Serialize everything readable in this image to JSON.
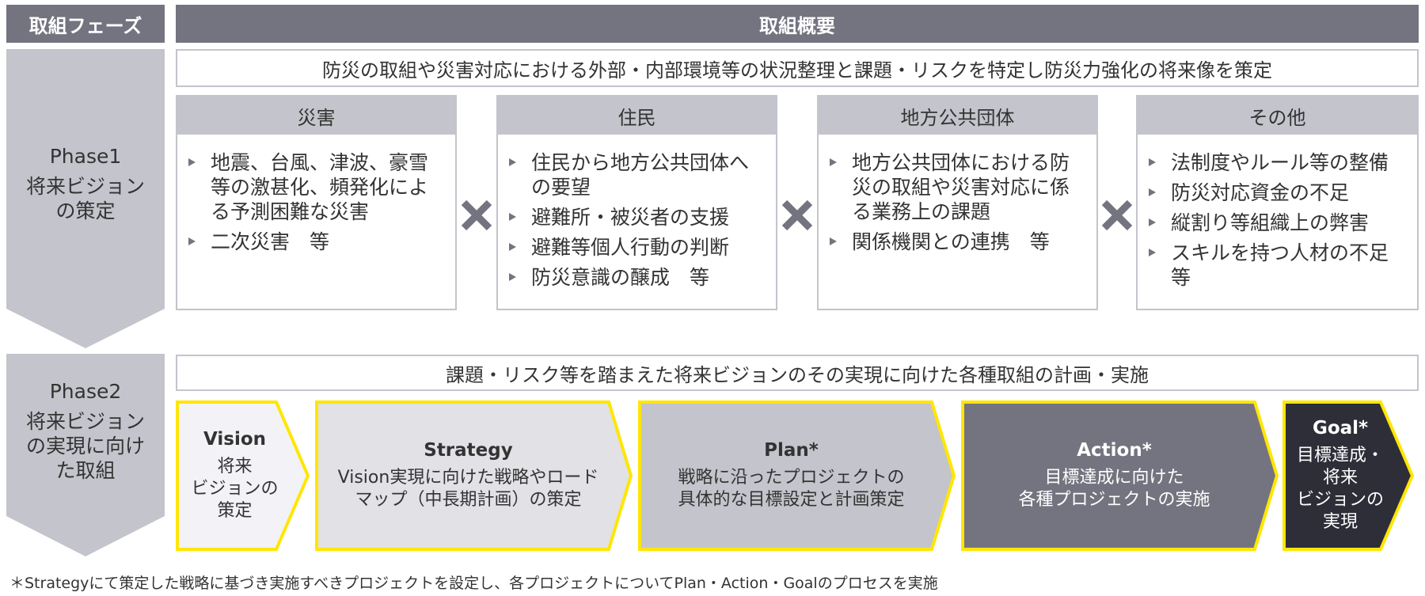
{
  "header": {
    "phase_col": "取組フェーズ",
    "overview_col": "取組概要"
  },
  "phase1": {
    "title": "Phase1",
    "subtitle": "将来ビジョン\nの策定",
    "summary": "防災の取組や災害対応における外部・内部環境等の状況整理と課題・リスクを特定し防災力強化の将来像を策定",
    "cards": [
      {
        "title": "災害",
        "items": [
          "地震、台風、津波、豪雪等の激甚化、頻発化による予測困難な災害",
          "二次災害　等"
        ]
      },
      {
        "title": "住民",
        "items": [
          "住民から地方公共団体への要望",
          "避難所・被災者の支援",
          "避難等個人行動の判断",
          "防災意識の醸成　等"
        ]
      },
      {
        "title": "地方公共団体",
        "items": [
          "地方公共団体における防災の取組や災害対応に係る業務上の課題",
          "関係機関との連携　等"
        ]
      },
      {
        "title": "その他",
        "items": [
          "法制度やルール等の整備",
          "防災対応資金の不足",
          "縦割り等組織上の弊害",
          "スキルを持つ人材の不足等"
        ]
      }
    ],
    "operator_icon": "multiply-icon"
  },
  "phase2": {
    "title": "Phase2",
    "subtitle": "将来ビジョン\nの実現に向け\nた取組",
    "summary": "課題・リスク等を踏まえた将来ビジョンのその実現に向けた各種取組の計画・実施",
    "steps": [
      {
        "title": "Vision",
        "desc": "将来\nビジョンの\n策定",
        "fill": "#f3f3f7",
        "text_color": "#333333"
      },
      {
        "title": "Strategy",
        "desc": "Vision実現に向けた戦略やロード\nマップ（中長期計画）の策定",
        "fill": "#e1e1e6",
        "text_color": "#333333"
      },
      {
        "title": "Plan*",
        "desc": "戦略に沿ったプロジェクトの\n具体的な目標設定と計画策定",
        "fill": "#c4c4cc",
        "text_color": "#333333"
      },
      {
        "title": "Action*",
        "desc": "目標達成に向けた\n各種プロジェクトの実施",
        "fill": "#747480",
        "text_color": "#ffffff"
      },
      {
        "title": "Goal*",
        "desc": "目標達成・\n将来\nビジョンの\n実現",
        "fill": "#2e2e38",
        "text_color": "#ffffff"
      }
    ]
  },
  "footnote": "＊Strategyにて策定した戦略に基づき実施すべきプロジェクトを設定し、各プロジェクトについてPlan・Action・Goalのプロセスを実施",
  "colors": {
    "header_bg": "#747480",
    "phase_arrow": "#c4c4cc",
    "card_border": "#c4c4cc",
    "accent_yellow": "#ffe600",
    "cross": "#747480"
  }
}
